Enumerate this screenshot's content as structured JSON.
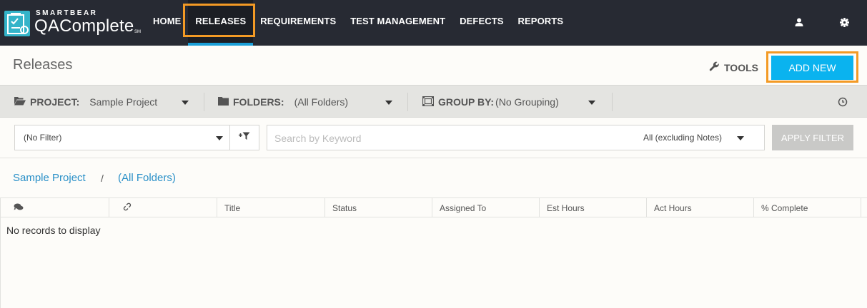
{
  "brand": {
    "company": "SMARTBEAR",
    "product": "QAComplete",
    "trademark": "SM",
    "logo_icon": "checklist-logo-icon"
  },
  "nav": {
    "items": [
      {
        "label": "HOME",
        "active": false
      },
      {
        "label": "RELEASES",
        "active": true
      },
      {
        "label": "REQUIREMENTS",
        "active": false
      },
      {
        "label": "TEST MANAGEMENT",
        "active": false
      },
      {
        "label": "DEFECTS",
        "active": false
      },
      {
        "label": "REPORTS",
        "active": false
      }
    ],
    "user_icon": "user-icon",
    "settings_icon": "gear-icon",
    "active_color": "#1a9fd8",
    "highlight_color": "#f39a25"
  },
  "header": {
    "title": "Releases",
    "tools_label": "TOOLS",
    "add_new_label": "ADD NEW",
    "add_new_color": "#0ab3ef"
  },
  "filterbar": {
    "project_label": "PROJECT:",
    "project_value": "Sample Project",
    "folders_label": "FOLDERS:",
    "folders_value": "(All Folders)",
    "group_label": "GROUP BY:",
    "group_value": "(No Grouping)"
  },
  "filter_row": {
    "filter_value": "(No Filter)",
    "search_placeholder": "Search by Keyword",
    "search_scope": "All (excluding Notes)",
    "apply_label": "APPLY FILTER"
  },
  "breadcrumb": {
    "project": "Sample Project",
    "separator": "/",
    "folder": "(All Folders)"
  },
  "grid": {
    "columns": [
      "Title",
      "Status",
      "Assigned To",
      "Est Hours",
      "Act Hours",
      "% Complete"
    ],
    "empty_message": "No records to display"
  }
}
